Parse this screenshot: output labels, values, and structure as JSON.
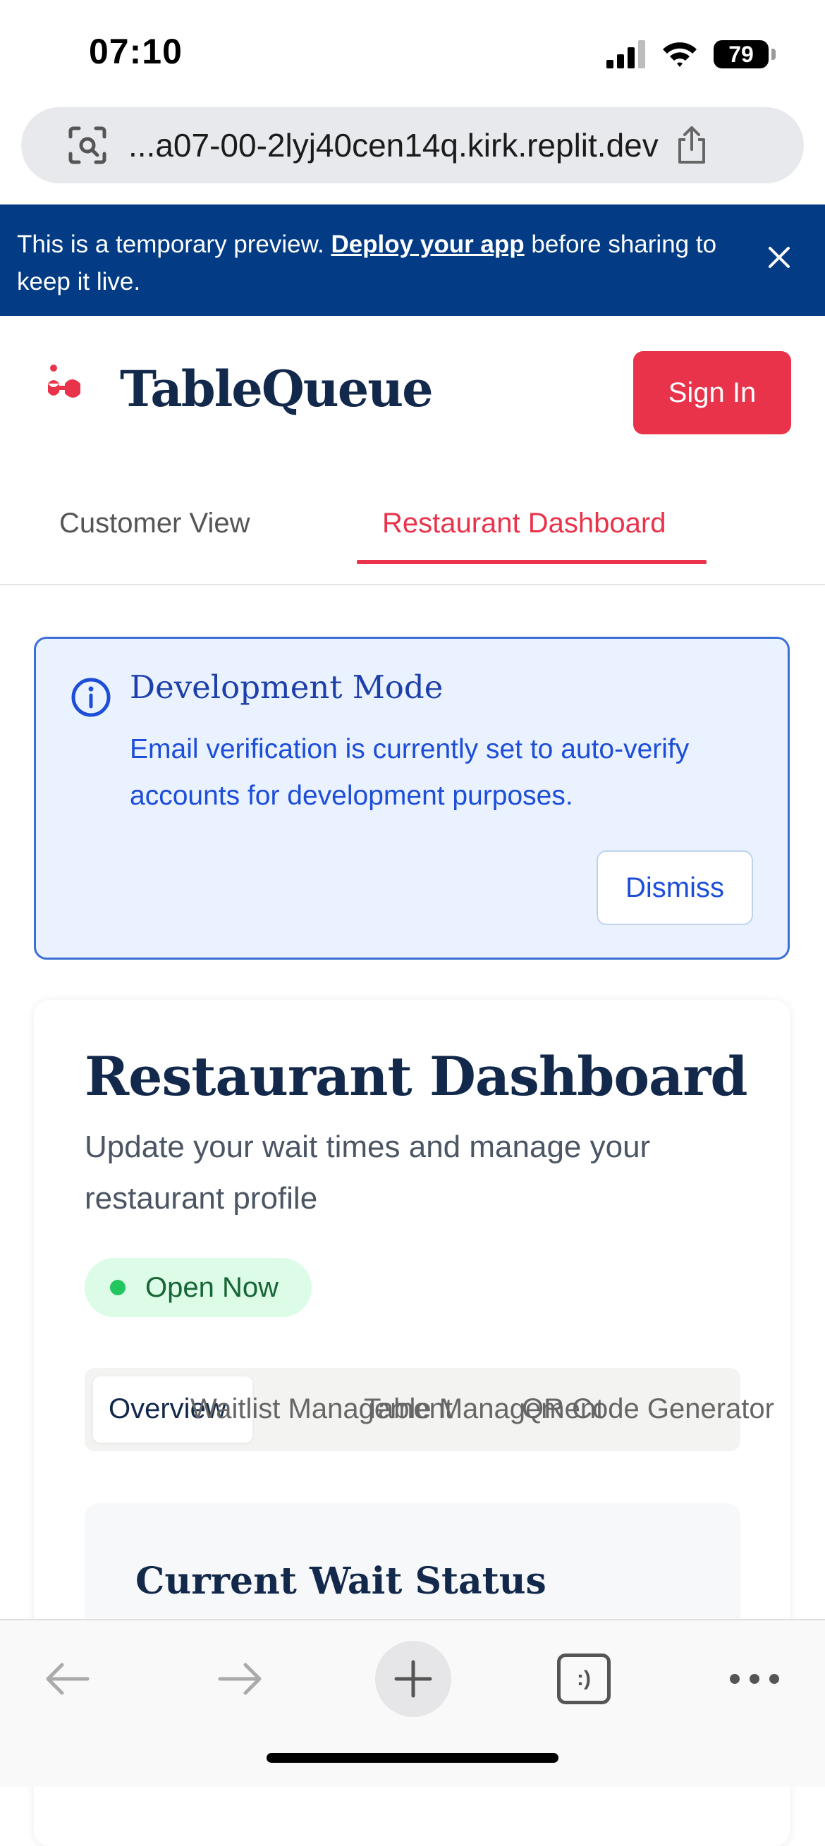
{
  "status_bar": {
    "time": "07:10",
    "battery": "79"
  },
  "browser": {
    "url": "...a07-00-2lyj40cen14q.kirk.replit.dev"
  },
  "preview_banner": {
    "text_before": "This is a temporary preview. ",
    "link": "Deploy your app",
    "text_after": " before sharing to keep it live."
  },
  "header": {
    "brand": "TableQueue",
    "sign_in": "Sign In"
  },
  "view_tabs": {
    "customer": "Customer View",
    "restaurant": "Restaurant Dashboard",
    "active": "restaurant"
  },
  "dev_notice": {
    "title": "Development Mode",
    "message": "Email verification is currently set to auto-verify accounts for development purposes.",
    "dismiss": "Dismiss"
  },
  "dashboard": {
    "title": "Restaurant Dashboard",
    "subtitle": "Update your wait times and manage your restaurant profile",
    "status_badge": "Open Now",
    "tabs": [
      "Overview",
      "Waitlist Management",
      "Table Management",
      "QR Code Generator"
    ],
    "section_title": "Current Wait Status"
  },
  "colors": {
    "accent": "#e8334a",
    "navy": "#13294b",
    "banner": "#033c85",
    "info": "#1d4ed8"
  }
}
